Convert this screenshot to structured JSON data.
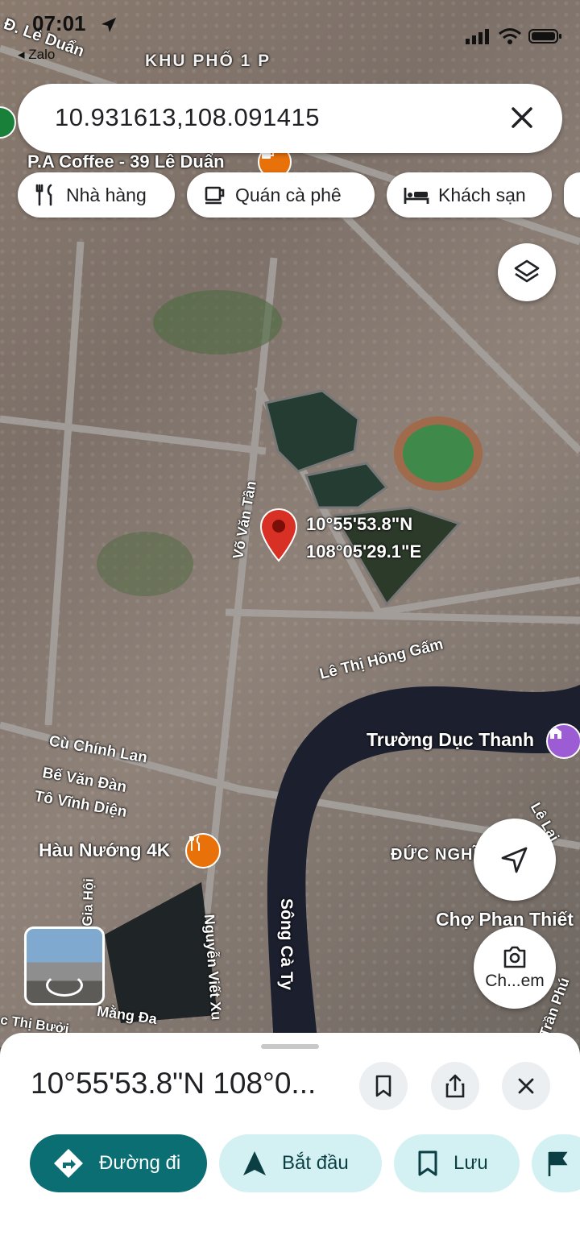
{
  "status_bar": {
    "time": "07:01",
    "back_app": "◂ Zalo"
  },
  "search": {
    "value": "10.931613,108.091415"
  },
  "chips": [
    {
      "label": "Nhà hàng",
      "icon": "restaurant-icon"
    },
    {
      "label": "Quán cà phê",
      "icon": "coffee-icon"
    },
    {
      "label": "Khách sạn",
      "icon": "hotel-icon"
    }
  ],
  "map": {
    "labels": {
      "le_duan_road": "Đ. Lê Duẩn",
      "khu_pho": "KHU PHỐ 1 P",
      "pa_coffee": "P.A Coffee - 39 Lê Duẩn",
      "vo_van_tan": "Võ Văn Tần",
      "le_thi_hong_gam": "Lê Thị Hồng Gấm",
      "truong_duc_thanh": "Trường Dục Thanh",
      "cu_chinh_lan": "Cù Chính Lan",
      "be_van_dan": "Bế Văn Đàn",
      "to_vinh_dien": "Tô Vĩnh Diện",
      "hau_nuong": "Hàu Nướng 4K",
      "duc_nghia": "ĐỨC NGHĨ",
      "cho_phan_thiet": "Chợ Phan Thiết",
      "song_ca_ty": "Sông Cà Ty",
      "nguyen_viet_xuan": "Nguyễn Viết Xu",
      "mang_da": "Mằng Đa",
      "le_lai": "Lê Lai",
      "tran_phu": "Trần Phú",
      "gia_hoi": "Gia Hội",
      "c_thi_buoi": "c Thị Bưởi"
    },
    "pin_lat": "10°55'53.8\"N",
    "pin_lng": "108°05'29.1\"E",
    "lens_label": "Ch...em"
  },
  "sheet": {
    "title": "10°55'53.8\"N 108°0...",
    "actions": [
      {
        "label": "Đường đi",
        "icon": "directions-icon"
      },
      {
        "label": "Bắt đầu",
        "icon": "navigate-arrow-icon"
      },
      {
        "label": "Lưu",
        "icon": "bookmark-icon"
      }
    ]
  },
  "colors": {
    "accent": "#0b6e73",
    "accent_light": "#d3f1f3",
    "pin": "#d93025"
  }
}
